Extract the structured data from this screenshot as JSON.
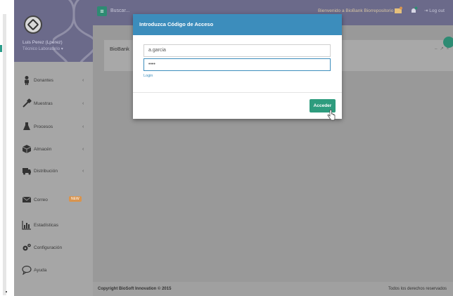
{
  "app": {
    "user_name": "Luis Perez (Lperez)",
    "user_role": "Técnico Laboratorio ▾",
    "search_placeholder": "Buscar...",
    "header_user": "Bienvenido a BioBank Biorrepositorio",
    "logout_label": "Log out",
    "brand_color": "#6b6a8a",
    "accent_color": "#2e8b73"
  },
  "sidebar": {
    "items": [
      {
        "label": "Donantes",
        "icon": "person-icon",
        "has_chevron": true
      },
      {
        "label": "Muestras",
        "icon": "pipette-icon",
        "has_chevron": true
      },
      {
        "label": "Procesos",
        "icon": "flask-icon",
        "has_chevron": true
      },
      {
        "label": "Almacén",
        "icon": "box-icon",
        "has_chevron": true
      },
      {
        "label": "Distribución",
        "icon": "truck-icon",
        "has_chevron": true
      },
      {
        "label": "Correo",
        "icon": "envelope-icon",
        "badge": "NEW"
      },
      {
        "label": "Estadísticas",
        "icon": "bar-chart-icon"
      },
      {
        "label": "Configuración",
        "icon": "gears-icon"
      },
      {
        "label": "Ayuda",
        "icon": "speech-bubble-icon"
      }
    ]
  },
  "content": {
    "card_title": "BioBank",
    "card_tools": "– ↗ ×"
  },
  "footer": {
    "copyright": "Copyright BioSoft Innovation © 2015",
    "rights": "Todos los derechos reservados"
  },
  "modal": {
    "title": "Introduzca Código de Acceso",
    "username_value": "a.garcia",
    "password_value": "••••",
    "login_link": "Login",
    "submit_label": "Acceder",
    "header_color": "#3c8dbc",
    "button_color": "#2e9c7e"
  }
}
